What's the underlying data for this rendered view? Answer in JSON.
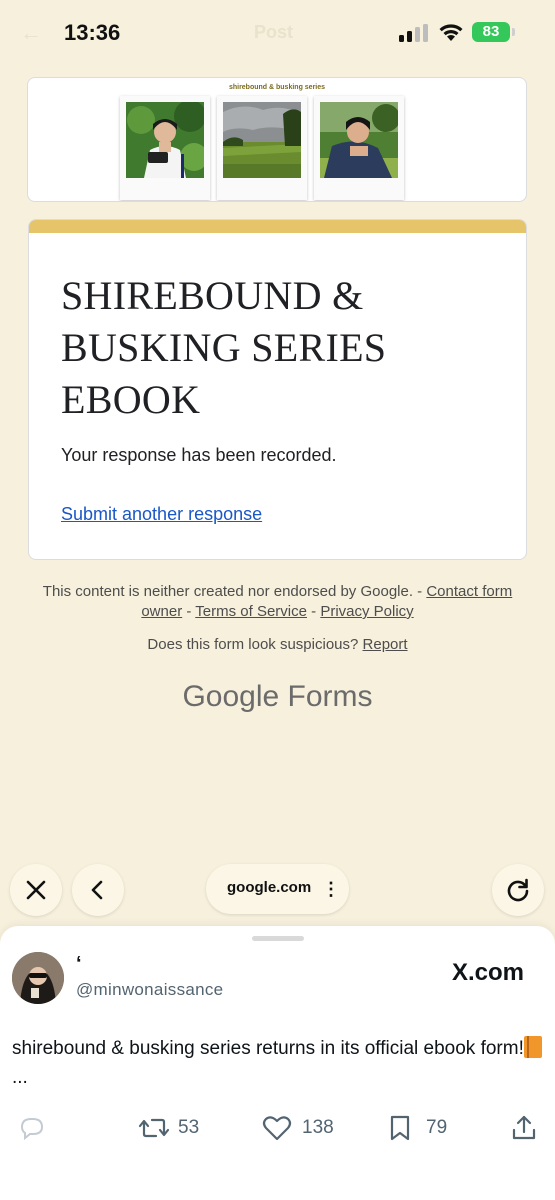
{
  "status_bar": {
    "time": "13:36",
    "battery": "83",
    "faint_title": "Post",
    "faint_back": "←"
  },
  "header_image": {
    "banner_title": "shirebound & busking series"
  },
  "form": {
    "title": "SHIREBOUND & BUSKING SERIES EBOOK",
    "message": "Your response has been recorded.",
    "submit_another": "Submit another response",
    "accent_color": "#e5c46a",
    "link_color": "#1a57c7"
  },
  "footer": {
    "disclaimer": "This content is neither created nor endorsed by Google. -",
    "contact_owner": "Contact form owner",
    "sep1": "-",
    "terms": "Terms of Service",
    "sep2": "-",
    "privacy": "Privacy Policy",
    "suspicious": "Does this form look suspicious?",
    "report": "Report",
    "brand_google": "Google",
    "brand_forms": "Forms"
  },
  "browser": {
    "url": "google.com",
    "icons": [
      "close-icon",
      "back-icon",
      "more-icon",
      "reload-icon"
    ]
  },
  "tweet": {
    "display_name": "‘",
    "handle": "@minwonaissance",
    "site": "X.com",
    "text": "shirebound & busking series returns in its official ebook form!",
    "ellipsis": "...",
    "retweets": "53",
    "likes": "138",
    "bookmarks": "79"
  }
}
